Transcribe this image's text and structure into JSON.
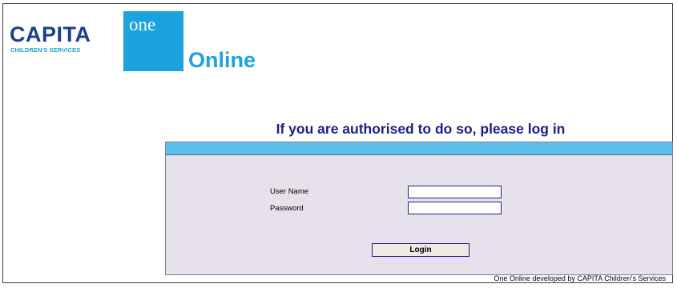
{
  "branding": {
    "capita_word": "CAPITA",
    "capita_sub": "CHILDREN'S SERVICES",
    "one_word": "one",
    "online_word": "Online",
    "colors": {
      "capita_blue": "#1b3e8f",
      "accent_cyan": "#1ba3df",
      "heading_navy": "#1d1d8a"
    }
  },
  "login": {
    "heading": "If you are authorised to do so, please log in",
    "username_label": "User Name",
    "password_label": "Password",
    "username_value": "",
    "password_value": "",
    "button_label": "Login"
  },
  "footer": {
    "text": "One Online developed by CAPITA Children's Services"
  }
}
